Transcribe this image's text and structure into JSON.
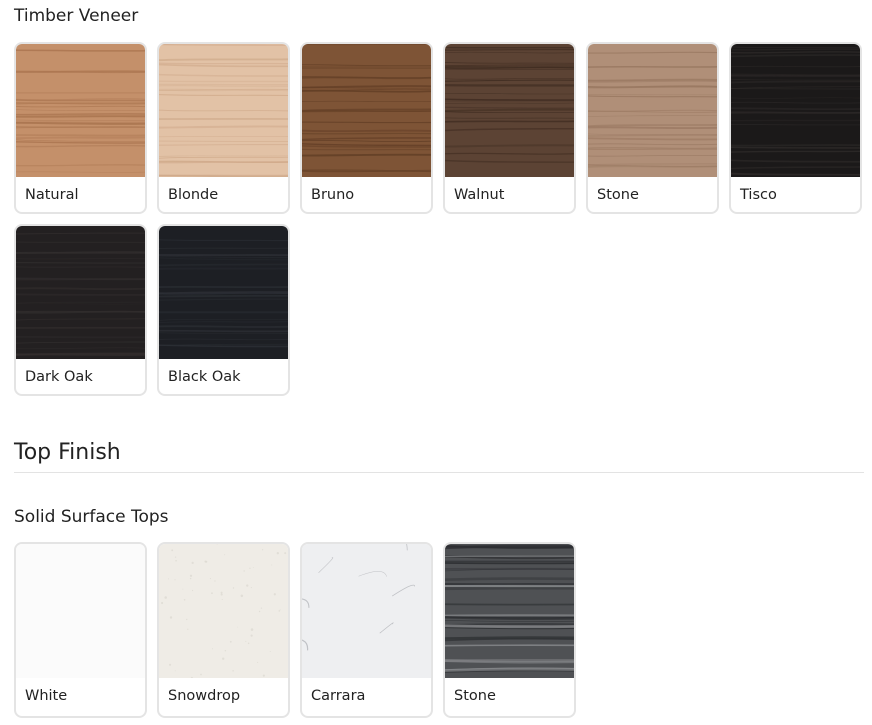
{
  "timber": {
    "heading": "Timber Veneer",
    "items": [
      {
        "label": "Natural",
        "icon": "natural-veneer-swatch",
        "base": "#c4906a",
        "grain": "#a9744f"
      },
      {
        "label": "Blonde",
        "icon": "blonde-veneer-swatch",
        "base": "#e2c2a6",
        "grain": "#cfa98a"
      },
      {
        "label": "Bruno",
        "icon": "bruno-veneer-swatch",
        "base": "#7e5436",
        "grain": "#5f3c24"
      },
      {
        "label": "Walnut",
        "icon": "walnut-veneer-swatch",
        "base": "#5c4334",
        "grain": "#3f2c21"
      },
      {
        "label": "Stone",
        "icon": "stone-veneer-swatch",
        "base": "#b08f78",
        "grain": "#97765f"
      },
      {
        "label": "Tisco",
        "icon": "tisco-veneer-swatch",
        "base": "#1b1919",
        "grain": "#302c2b"
      },
      {
        "label": "Dark Oak",
        "icon": "dark-oak-veneer-swatch",
        "base": "#232021",
        "grain": "#322e2e"
      },
      {
        "label": "Black Oak",
        "icon": "black-oak-veneer-swatch",
        "base": "#1d1f24",
        "grain": "#2c2f35"
      }
    ]
  },
  "top_finish": {
    "heading": "Top Finish"
  },
  "solid": {
    "heading": "Solid Surface Tops",
    "items": [
      {
        "label": "White",
        "icon": "white-surface-swatch",
        "base": "#fbfbfb",
        "grain": "#f5f5f5"
      },
      {
        "label": "Snowdrop",
        "icon": "snowdrop-surface-swatch",
        "base": "#efece6",
        "grain": "#dcd8d0"
      },
      {
        "label": "Carrara",
        "icon": "carrara-marble-swatch",
        "base": "#eeeff1",
        "grain": "#9a9ca2"
      },
      {
        "label": "Stone",
        "icon": "stone-surface-swatch",
        "base": "#4f5154",
        "grain": "#2c2e31"
      }
    ]
  }
}
